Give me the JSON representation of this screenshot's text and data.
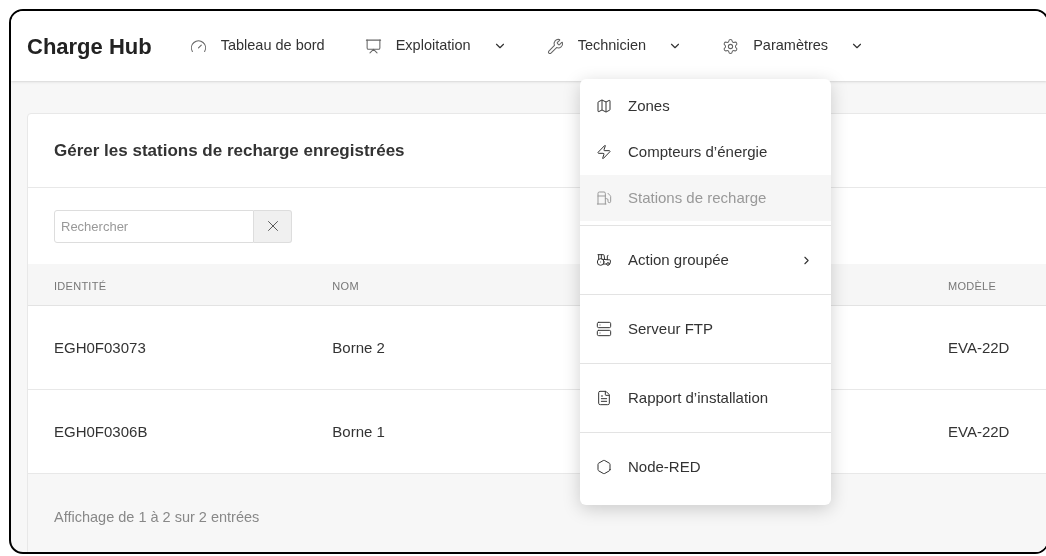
{
  "app": {
    "title": "Charge Hub"
  },
  "nav": [
    {
      "label": "Tableau de bord",
      "dropdown": false
    },
    {
      "label": "Exploitation",
      "dropdown": true
    },
    {
      "label": "Technicien",
      "dropdown": true
    },
    {
      "label": "Paramètres",
      "dropdown": true
    }
  ],
  "menu": {
    "groups": [
      [
        {
          "label": "Zones",
          "selected": false,
          "submenu": false
        },
        {
          "label": "Compteurs d’énergie",
          "selected": false,
          "submenu": false
        },
        {
          "label": "Stations de recharge",
          "selected": true,
          "submenu": false
        }
      ],
      [
        {
          "label": "Action groupée",
          "selected": false,
          "submenu": true
        }
      ],
      [
        {
          "label": "Serveur FTP",
          "selected": false,
          "submenu": false
        }
      ],
      [
        {
          "label": "Rapport d’installation",
          "selected": false,
          "submenu": false
        }
      ],
      [
        {
          "label": "Node-RED",
          "selected": false,
          "submenu": false
        }
      ]
    ]
  },
  "card": {
    "title": "Gérer les stations de recharge enregistrées",
    "search": {
      "placeholder": "Rechercher"
    },
    "table": {
      "columns": [
        "IDENTITÉ",
        "NOM",
        "MODÈLE"
      ],
      "rows": [
        [
          "EGH0F03073",
          "Borne 2",
          "EVA-22D"
        ],
        [
          "EGH0F0306B",
          "Borne 1",
          "EVA-22D"
        ]
      ]
    },
    "footer": "Affichage de 1 à 2 sur 2 entrées"
  }
}
